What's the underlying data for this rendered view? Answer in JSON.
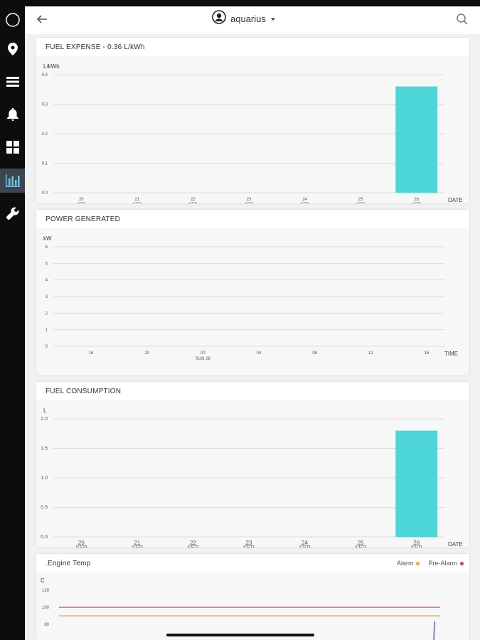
{
  "topbar": {
    "user_name": "aquarius"
  },
  "sidebar": {
    "items": [
      {
        "icon": "logo-circle-icon"
      },
      {
        "icon": "map-pin-icon"
      },
      {
        "icon": "list-icon"
      },
      {
        "icon": "bell-icon"
      },
      {
        "icon": "dashboard-grid-icon"
      },
      {
        "icon": "bar-chart-icon",
        "active": true
      },
      {
        "icon": "wrench-icon"
      }
    ]
  },
  "cards": {
    "fuel_expense": {
      "title": "FUEL EXPENSE - 0.36 L/kWh"
    },
    "power_generated": {
      "title": "POWER GENERATED"
    },
    "fuel_consumption": {
      "title": "FUEL CONSUMPTION"
    },
    "engine_temp": {
      "title": ".Engine Temp",
      "legend_alarm": "Alarm",
      "legend_prealarm": "Pre-Alarm"
    }
  },
  "colors": {
    "bar": "#4dd6d8",
    "alarm": "#f5a623",
    "prealarm": "#e53935",
    "sidebar_active": "#3d4650"
  },
  "chart_data": [
    {
      "type": "bar",
      "title": "FUEL EXPENSE - 0.36 L/kWh",
      "ylabel": "L/kWh",
      "xlabel": "DATE",
      "categories": [
        [
          "20",
          "SEP"
        ],
        [
          "21",
          "SEP"
        ],
        [
          "22",
          "SEP"
        ],
        [
          "23",
          "SEP"
        ],
        [
          "24",
          "SEP"
        ],
        [
          "25",
          "SEP"
        ],
        [
          "26",
          "SEP"
        ]
      ],
      "values": [
        0,
        0,
        0,
        0,
        0,
        0,
        0.36
      ],
      "yticks": [
        "0.0",
        "0.1",
        "0.2",
        "0.3",
        "0.4"
      ],
      "ylim": [
        0,
        0.4
      ]
    },
    {
      "type": "line",
      "title": "POWER GENERATED",
      "ylabel": "kW",
      "xlabel": "TIME",
      "xticks": [
        [
          "16",
          ""
        ],
        [
          "20",
          ""
        ],
        [
          "00",
          "SUN 26"
        ],
        [
          "04",
          ""
        ],
        [
          "08",
          ""
        ],
        [
          "12",
          ""
        ],
        [
          "16",
          ""
        ]
      ],
      "yticks": [
        "0",
        "1",
        "2",
        "3",
        "4",
        "5",
        "6"
      ],
      "ylim": [
        0,
        6
      ],
      "values": []
    },
    {
      "type": "bar",
      "title": "FUEL CONSUMPTION",
      "ylabel": "L",
      "xlabel": "DATE",
      "categories": [
        [
          "20",
          "SEP"
        ],
        [
          "21",
          "SEP"
        ],
        [
          "22",
          "SEP"
        ],
        [
          "23",
          "SEP"
        ],
        [
          "24",
          "SEP"
        ],
        [
          "25",
          "SEP"
        ],
        [
          "26",
          "SEP"
        ]
      ],
      "values": [
        0,
        0,
        0,
        0,
        0,
        0,
        1.8
      ],
      "yticks": [
        "0.0",
        "0.5",
        "1.0",
        "1.5",
        "2.0"
      ],
      "ylim": [
        0,
        2.0
      ]
    },
    {
      "type": "line",
      "title": ".Engine Temp",
      "ylabel": "C",
      "yticks": [
        "80",
        "100",
        "120"
      ],
      "ylim": [
        70,
        130
      ],
      "thresholds": [
        {
          "name": "Pre-Alarm",
          "value": 100
        },
        {
          "name": "Alarm",
          "value": 90
        }
      ]
    }
  ]
}
